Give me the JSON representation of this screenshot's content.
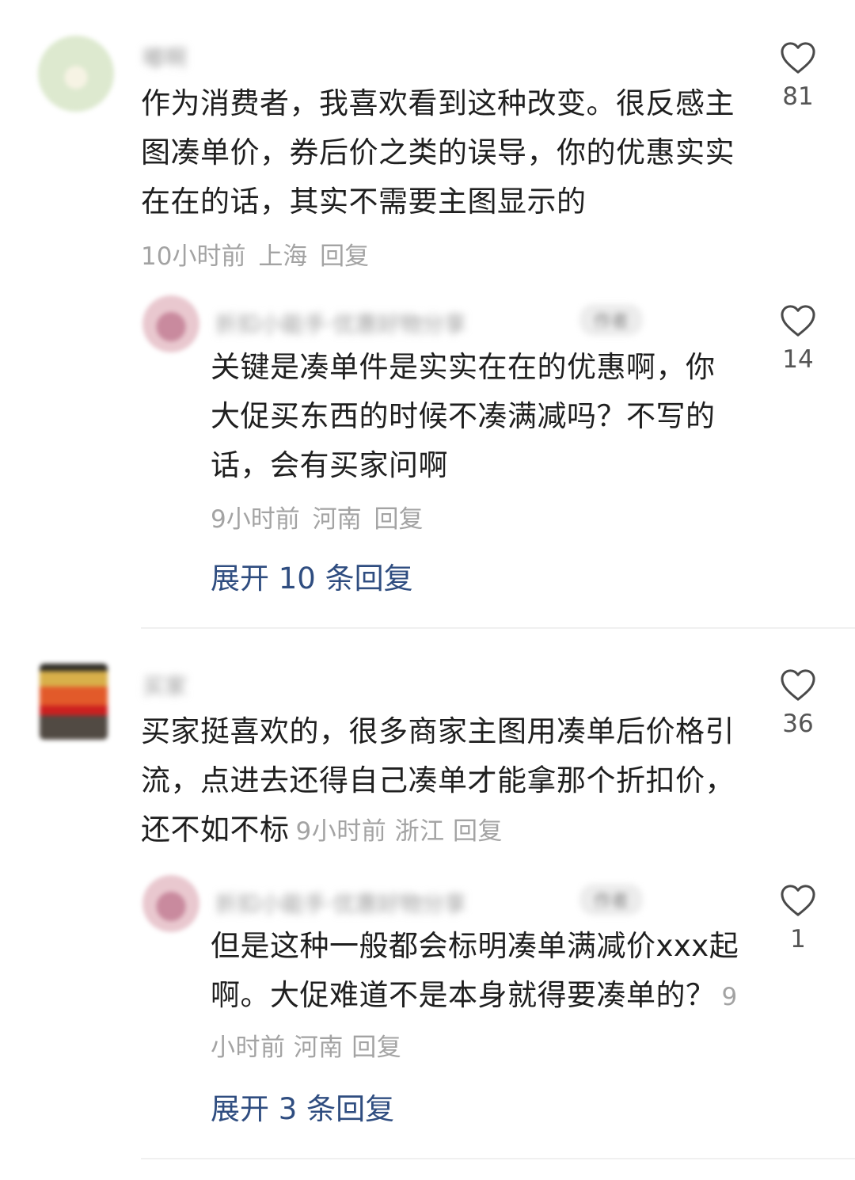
{
  "comments": [
    {
      "username": "嘟啊",
      "text": "作为消费者，我喜欢看到这种改变。很反感主图凑单价，券后价之类的误导，你的优惠实实在在的话，其实不需要主图显示的",
      "time": "10小时前",
      "location": "上海",
      "reply_label": "回复",
      "likes": "81",
      "reply": {
        "username": "折扣小能手·优惠好物分享",
        "tag": "作者",
        "text": "关键是凑单件是实实在在的优惠啊，你大促买东西的时候不凑满减吗？不写的话，会有买家问啊",
        "time": "9小时前",
        "location": "河南",
        "reply_label": "回复",
        "likes": "14"
      },
      "expand_label": "展开 10 条回复"
    },
    {
      "username": "买家",
      "text": "买家挺喜欢的，很多商家主图用凑单后价格引流，点进去还得自己凑单才能拿那个折扣价，还不如不标",
      "time": "9小时前",
      "location": "浙江",
      "reply_label": "回复",
      "likes": "36",
      "reply": {
        "username": "折扣小能手·优惠好物分享",
        "tag": "作者",
        "text": "但是这种一般都会标明凑单满减价xxx起啊。大促难道不是本身就得要凑单的？",
        "time": "9小时前",
        "location": "河南",
        "reply_label": "回复",
        "likes": "1"
      },
      "expand_label": "展开 3 条回复"
    }
  ],
  "colors": {
    "text": "#1f1f1f",
    "meta": "#a3a3a3",
    "link": "#2f4d80",
    "divider": "#f0f0f0"
  },
  "icons": {
    "like": "heart-outline-icon"
  }
}
